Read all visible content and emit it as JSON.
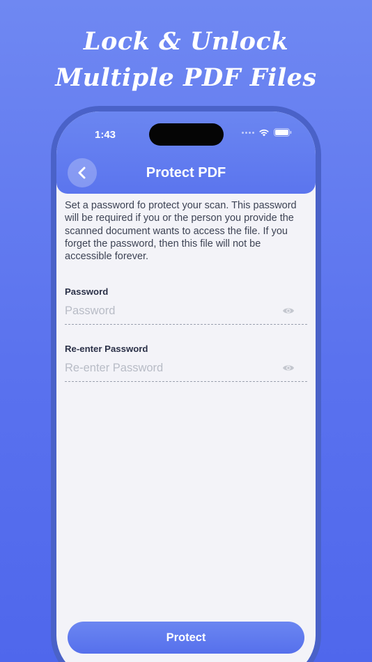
{
  "promo": {
    "line1": "Lock & Unlock",
    "line2": "Multiple PDF Files"
  },
  "status_bar": {
    "time": "1:43",
    "icons": [
      "signal-dots-icon",
      "wifi-icon",
      "battery-icon"
    ]
  },
  "header": {
    "title": "Protect PDF",
    "back_icon": "chevron-left-icon"
  },
  "description": "Set a password fo protect your scan. This password will be required if you or the person you provide the scanned document wants to access the file. If you forget the password, then this file will not be accessible forever.",
  "fields": [
    {
      "label": "Password",
      "placeholder": "Password",
      "value": "",
      "icon": "eye-icon"
    },
    {
      "label": "Re-enter Password",
      "placeholder": "Re-enter Password",
      "value": "",
      "icon": "eye-icon"
    }
  ],
  "actions": {
    "protect_label": "Protect"
  },
  "colors": {
    "background": "#5a72ee",
    "accent": "#6b86f1",
    "screen": "#f3f3f8"
  }
}
